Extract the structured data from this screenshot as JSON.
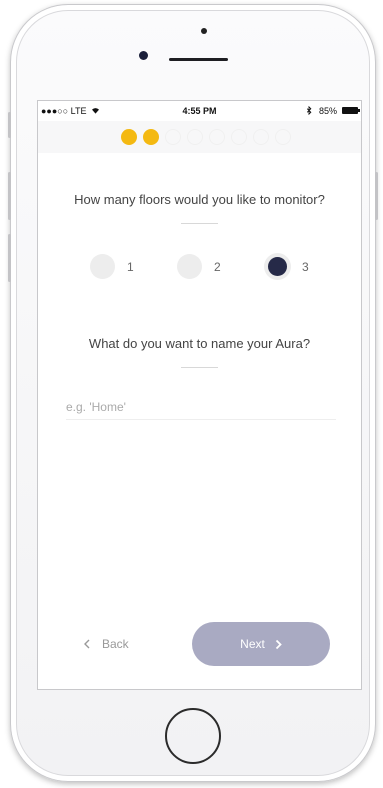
{
  "status_bar": {
    "carrier": "●●●○○ LTE",
    "wifi_icon": "wifi-icon",
    "time": "4:55 PM",
    "bluetooth_icon": "bluetooth-icon",
    "battery": "85%"
  },
  "progress": {
    "total_steps": 8,
    "completed_steps": 2,
    "accent_color": "#f4b912"
  },
  "floors": {
    "question": "How many floors would you like to monitor?",
    "options": [
      "1",
      "2",
      "3"
    ],
    "selected": "3"
  },
  "name": {
    "question": "What do you want to name your Aura?",
    "placeholder": "e.g. 'Home'",
    "value": ""
  },
  "nav": {
    "back_label": "Back",
    "back_icon": "chevron-left-icon",
    "next_label": "Next",
    "next_icon": "chevron-right-icon",
    "next_color": "#a9aac2"
  }
}
